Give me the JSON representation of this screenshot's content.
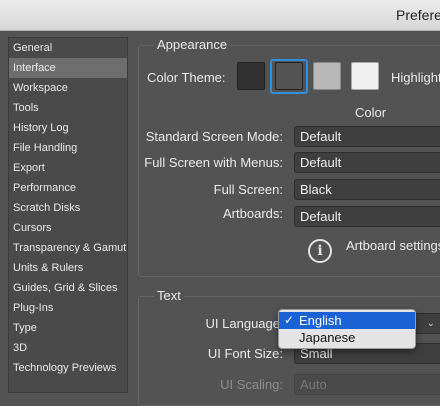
{
  "window": {
    "title": "Prefere"
  },
  "sidebar": {
    "items": [
      {
        "label": "General"
      },
      {
        "label": "Interface",
        "selected": true
      },
      {
        "label": "Workspace"
      },
      {
        "label": "Tools"
      },
      {
        "label": "History Log"
      },
      {
        "label": "File Handling"
      },
      {
        "label": "Export"
      },
      {
        "label": "Performance"
      },
      {
        "label": "Scratch Disks"
      },
      {
        "label": "Cursors"
      },
      {
        "label": "Transparency & Gamut"
      },
      {
        "label": "Units & Rulers"
      },
      {
        "label": "Guides, Grid & Slices"
      },
      {
        "label": "Plug-Ins"
      },
      {
        "label": "Type"
      },
      {
        "label": "3D"
      },
      {
        "label": "Technology Previews"
      }
    ]
  },
  "appearance": {
    "group_label": "Appearance",
    "color_theme_label": "Color Theme:",
    "highlight_label": "Highlight",
    "color_column_label": "Color",
    "themes": [
      {
        "name": "darkest",
        "color": "#323232"
      },
      {
        "name": "dark",
        "color": "#535353",
        "selected": true
      },
      {
        "name": "light",
        "color": "#b8b8b8"
      },
      {
        "name": "lightest",
        "color": "#f0f0f0"
      }
    ],
    "standard_screen_mode": {
      "label": "Standard Screen Mode:",
      "value": "Default"
    },
    "full_screen_with_menus": {
      "label": "Full Screen with Menus:",
      "value": "Default"
    },
    "full_screen": {
      "label": "Full Screen:",
      "value": "Black"
    },
    "artboards": {
      "label": "Artboards:",
      "value": "Default"
    },
    "artboard_note": "Artboard settings"
  },
  "text": {
    "group_label": "Text",
    "ui_language": {
      "label": "UI Language",
      "options": [
        {
          "label": "English",
          "selected": true
        },
        {
          "label": "Japanese"
        }
      ],
      "checkmark": "✓"
    },
    "ui_font_size": {
      "label": "UI Font Size:",
      "value": "Small"
    },
    "ui_scaling": {
      "label": "UI Scaling:",
      "value": "Auto"
    }
  },
  "colors": {
    "accent": "#2f8fe0",
    "menu_selection": "#1b62d6",
    "panel_bg": "#535353"
  }
}
